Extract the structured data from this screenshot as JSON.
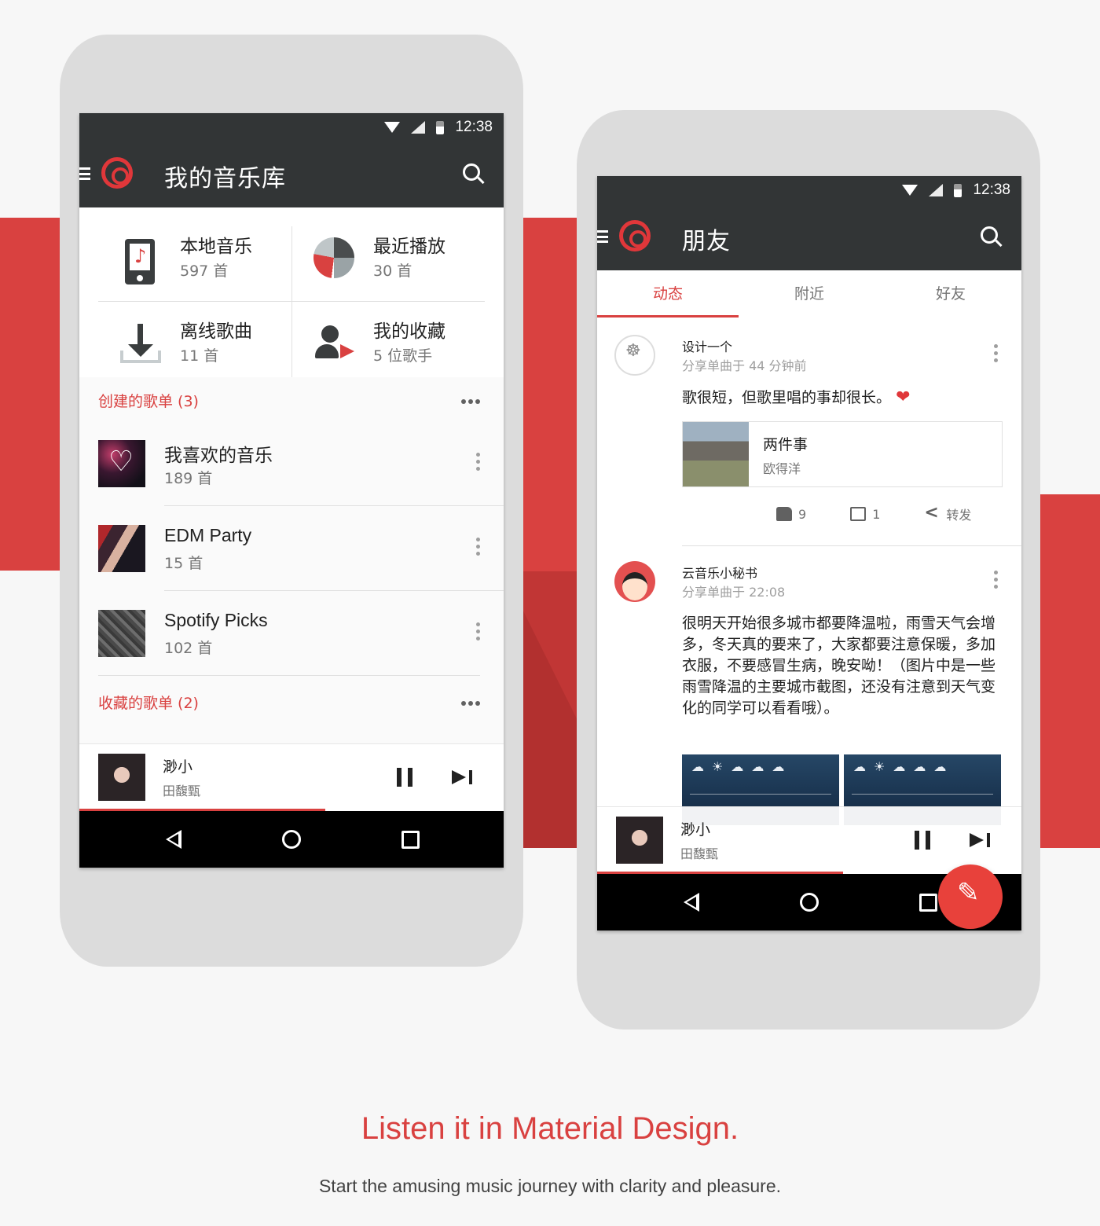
{
  "status_bar": {
    "time": "12:38"
  },
  "left_screen": {
    "title": "我的音乐库",
    "grid": [
      {
        "name": "本地音乐",
        "count": "597 首",
        "icon": "local-music-icon"
      },
      {
        "name": "最近播放",
        "count": "30 首",
        "icon": "recent-play-icon"
      },
      {
        "name": "离线歌曲",
        "count": "11 首",
        "icon": "download-icon"
      },
      {
        "name": "我的收藏",
        "count": "5 位歌手",
        "icon": "favorite-artist-icon"
      }
    ],
    "created_section": "创建的歌单 (3)",
    "playlists": [
      {
        "name": "我喜欢的音乐",
        "count": "189 首"
      },
      {
        "name": "EDM Party",
        "count": "15 首"
      },
      {
        "name": "Spotify Picks",
        "count": "102 首"
      }
    ],
    "collected_section": "收藏的歌单 (2)",
    "now_playing": {
      "song": "渺小",
      "artist": "田馥甄",
      "progress": 0.58
    }
  },
  "right_screen": {
    "title": "朋友",
    "tabs": [
      "动态",
      "附近",
      "好友"
    ],
    "posts": [
      {
        "user": "设计一个",
        "meta": "分享单曲于 44 分钟前",
        "text": "歌很短，但歌里唱的事却很长。",
        "shared_song": "两件事",
        "shared_artist": "欧得洋",
        "likes": "9",
        "comments": "1",
        "share_label": "转发"
      },
      {
        "user": "云音乐小秘书",
        "meta": "分享单曲于 22:08",
        "text": "很明天开始很多城市都要降温啦，雨雪天气会增多，冬天真的要来了，大家都要注意保暖，多加衣服，不要感冒生病，晚安呦！（图片中是一些雨雪降温的主要城市截图，还没有注意到天气变化的同学可以看看哦）。"
      }
    ],
    "now_playing": {
      "song": "渺小",
      "artist": "田馥甄",
      "progress": 0.58
    }
  },
  "tagline": "Listen it in Material Design.",
  "subline": "Start the amusing music journey with clarity and pleasure.",
  "colors": {
    "accent": "#d94140",
    "appbar": "#323536"
  }
}
